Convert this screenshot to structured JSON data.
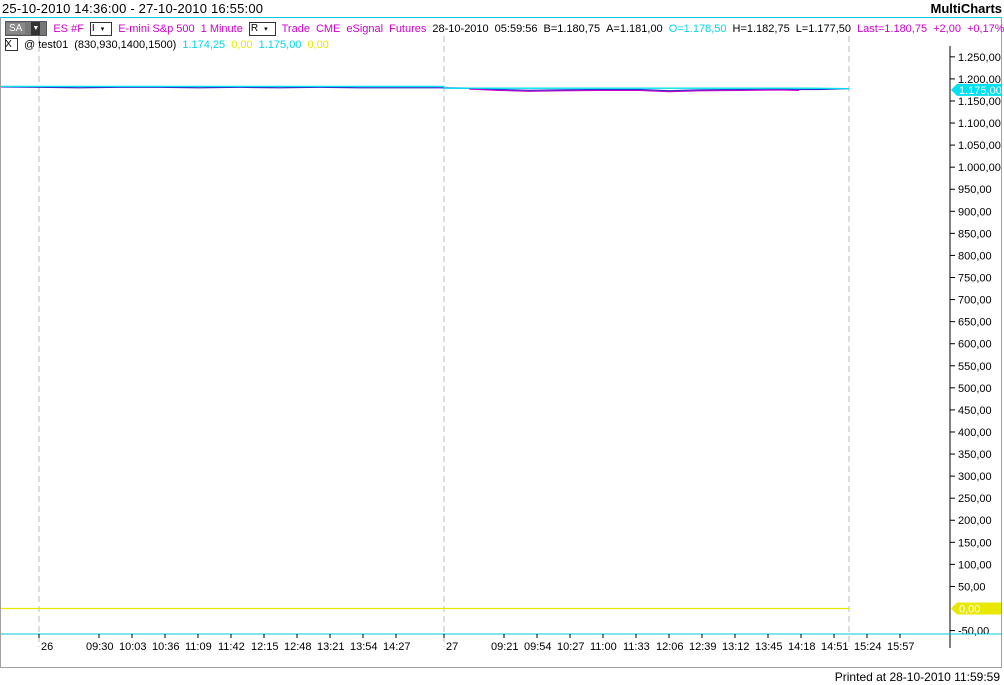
{
  "header": {
    "range": "25-10-2010 14:36:00 - 27-10-2010 16:55:00",
    "brand": "MultiCharts"
  },
  "instrument_row": {
    "sa_button": "SA",
    "symbol": "ES #F",
    "interval_menu": "I",
    "description": "E-mini S&p 500",
    "resolution": "1 Minute",
    "range_menu": "R",
    "data_type": "Trade",
    "exchange": "CME",
    "feed": "eSignal",
    "category": "Futures",
    "date": "28-10-2010",
    "time": "05:59:56",
    "bid": "B=1.180,75",
    "ask": "A=1.181,00",
    "open": "O=1.178,50",
    "high": "H=1.182,75",
    "low": "L=1.177,50",
    "last": "Last=1.180,75",
    "change": "+2,00",
    "change_pct": "+0,17%"
  },
  "study_row": {
    "close_glyph": "X",
    "study": "@ test01",
    "params": "(830,930,1400,1500)",
    "v1": "1.174,25",
    "v2": "0,00",
    "v3": "1.175,00",
    "v4": "0,00"
  },
  "footer": {
    "printed": "Printed at 28-10-2010 11:59:59"
  },
  "colors": {
    "price_line": "#3333cc",
    "price_alt": "#cc00cc",
    "indicator_cyan": "#00e0f0",
    "indicator_yellow": "#e8e800",
    "axis_cyan": "#00c8d8"
  },
  "chart_data": {
    "type": "line",
    "title": "",
    "ylim": [
      -60,
      1270
    ],
    "y_ticks": [
      "1.250,00",
      "1.200,00",
      "1.150,00",
      "1.100,00",
      "1.050,00",
      "1.000,00",
      "950,00",
      "900,00",
      "850,00",
      "800,00",
      "750,00",
      "700,00",
      "650,00",
      "600,00",
      "550,00",
      "500,00",
      "450,00",
      "400,00",
      "350,00",
      "300,00",
      "250,00",
      "200,00",
      "150,00",
      "100,00",
      "50,00",
      "-50,00"
    ],
    "y_tick_values": [
      1250,
      1200,
      1150,
      1100,
      1050,
      1000,
      950,
      900,
      850,
      800,
      750,
      700,
      650,
      600,
      550,
      500,
      450,
      400,
      350,
      300,
      250,
      200,
      150,
      100,
      50,
      -50
    ],
    "x_ticks": [
      {
        "label": "26",
        "idx": 0
      },
      {
        "label": "09:30",
        "idx": 60
      },
      {
        "label": "10:03",
        "idx": 93
      },
      {
        "label": "10:36",
        "idx": 126
      },
      {
        "label": "11:09",
        "idx": 159
      },
      {
        "label": "11:42",
        "idx": 192
      },
      {
        "label": "12:15",
        "idx": 225
      },
      {
        "label": "12:48",
        "idx": 258
      },
      {
        "label": "13:21",
        "idx": 291
      },
      {
        "label": "13:54",
        "idx": 324
      },
      {
        "label": "14:27",
        "idx": 357
      },
      {
        "label": "27",
        "idx": 405
      },
      {
        "label": "09:21",
        "idx": 465
      },
      {
        "label": "09:54",
        "idx": 498
      },
      {
        "label": "10:27",
        "idx": 531
      },
      {
        "label": "11:00",
        "idx": 564
      },
      {
        "label": "11:33",
        "idx": 597
      },
      {
        "label": "12:06",
        "idx": 630
      },
      {
        "label": "12:39",
        "idx": 663
      },
      {
        "label": "13:12",
        "idx": 696
      },
      {
        "label": "13:45",
        "idx": 729
      },
      {
        "label": "14:18",
        "idx": 762
      },
      {
        "label": "14:51",
        "idx": 795
      },
      {
        "label": "15:24",
        "idx": 828
      },
      {
        "label": "15:57",
        "idx": 861
      }
    ],
    "x_range": [
      -38,
      907
    ],
    "session_separators": [
      0,
      405,
      810
    ],
    "series": [
      {
        "name": "ES #F",
        "color": "#3333cc",
        "points": [
          [
            -38,
            1182
          ],
          [
            0,
            1181
          ],
          [
            40,
            1180
          ],
          [
            80,
            1181
          ],
          [
            120,
            1181
          ],
          [
            160,
            1180
          ],
          [
            200,
            1181
          ],
          [
            240,
            1180
          ],
          [
            280,
            1181
          ],
          [
            320,
            1180
          ],
          [
            360,
            1180
          ],
          [
            400,
            1180
          ],
          [
            430,
            1179
          ],
          [
            460,
            1176
          ],
          [
            490,
            1174
          ],
          [
            520,
            1175
          ],
          [
            560,
            1176
          ],
          [
            600,
            1176
          ],
          [
            630,
            1173
          ],
          [
            660,
            1175
          ],
          [
            700,
            1176
          ],
          [
            740,
            1177
          ],
          [
            760,
            1176
          ],
          [
            780,
            1176
          ],
          [
            810,
            1178
          ]
        ]
      },
      {
        "name": "test01",
        "color": "#00e0f0",
        "points": [
          [
            -38,
            1183
          ],
          [
            405,
            1183
          ],
          [
            405,
            1179
          ],
          [
            770,
            1179
          ],
          [
            810,
            1178
          ]
        ]
      },
      {
        "name": "test01 (2)",
        "color": "#e8e800",
        "points": [
          [
            -38,
            0
          ],
          [
            810,
            0
          ]
        ]
      }
    ],
    "last_markers": [
      {
        "label": "1.175,00",
        "value": 1175,
        "color": "#00e0f0"
      },
      {
        "label": "0,00",
        "value": 0,
        "color": "#e8e800"
      }
    ]
  }
}
